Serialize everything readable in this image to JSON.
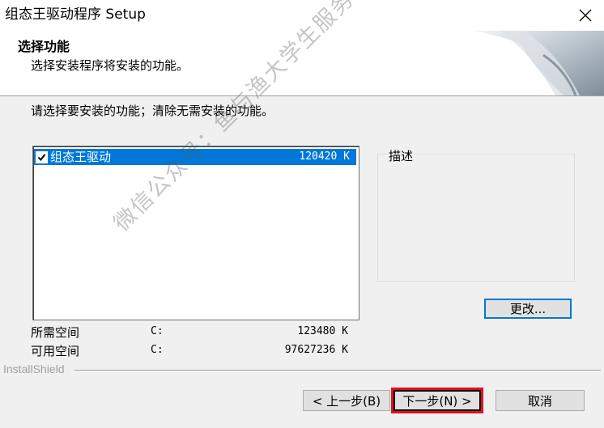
{
  "window": {
    "title": "组态王驱动程序 Setup",
    "close_symbol": "✕"
  },
  "header": {
    "title": "选择功能",
    "subtitle": "选择安装程序将安装的功能。"
  },
  "instruction": "请选择要安装的功能；清除无需安装的功能。",
  "features": [
    {
      "name": "组态王驱动",
      "size": "120420 K",
      "checked": true,
      "selected": true
    }
  ],
  "description": {
    "label": "描述"
  },
  "change_button": "更改...",
  "space": {
    "required": {
      "label": "所需空间",
      "drive": "C:",
      "value": "123480 K"
    },
    "available": {
      "label": "可用空间",
      "drive": "C:",
      "value": "97627236 K"
    }
  },
  "branding": "InstallShield",
  "buttons": {
    "back": "< 上一步(B)",
    "next": "下一步(N) >",
    "cancel": "取消"
  },
  "watermark": "微信公众号：鱼与渔大学生服务",
  "colors": {
    "selection": "#0078d7",
    "highlight_box": "#e0101a"
  }
}
